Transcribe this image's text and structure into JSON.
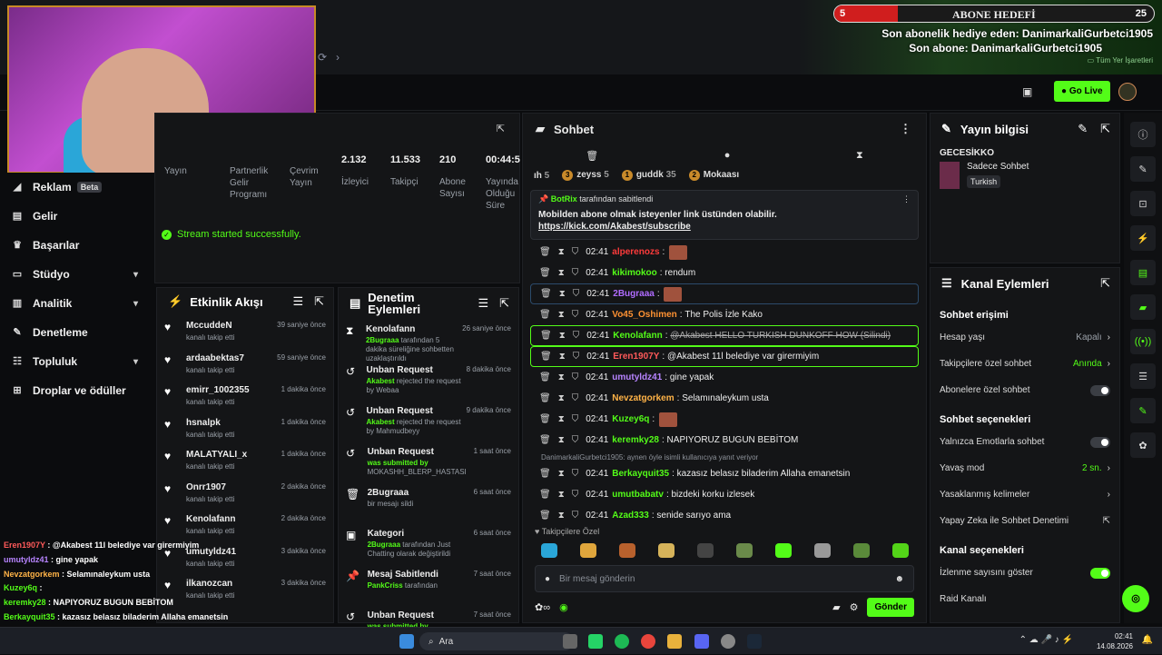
{
  "overlay": {
    "sub_goal_title": "ABONE HEDEFİ",
    "sub_goal_left": "5",
    "sub_goal_right": "25",
    "last_gift": "Son abonelik hediye eden: DanimarkaliGurbetci1905",
    "last_sub": "Son abone: DanimarkaliGurbetci1905",
    "bookmarks": "Tüm Yer İşaretleri"
  },
  "header": {
    "go_live": "Go Live"
  },
  "sidebar": {
    "items": [
      {
        "label": "Reklam",
        "icon": "megaphone-icon",
        "badge": "Beta"
      },
      {
        "label": "Gelir",
        "icon": "revenue-icon"
      },
      {
        "label": "Başarılar",
        "icon": "trophy-icon"
      },
      {
        "label": "Stüdyo",
        "icon": "studio-icon",
        "chevron": true
      },
      {
        "label": "Analitik",
        "icon": "chart-icon",
        "chevron": true
      },
      {
        "label": "Denetleme",
        "icon": "wrench-icon"
      },
      {
        "label": "Topluluk",
        "icon": "people-icon",
        "chevron": true
      },
      {
        "label": "Droplar ve ödüller",
        "icon": "gift-icon"
      }
    ]
  },
  "stats": {
    "items": [
      {
        "value": "",
        "label": "Yayın"
      },
      {
        "value": "",
        "label": "Partnerlik Gelir Programı"
      },
      {
        "value": "",
        "label": "Çevrim Yayın"
      },
      {
        "value": "2.132",
        "label": "İzleyici"
      },
      {
        "value": "11.533",
        "label": "Takipçi"
      },
      {
        "value": "210",
        "label": "Abone Sayısı"
      },
      {
        "value": "00:44:5",
        "label": "Yayında Olduğu Süre"
      }
    ],
    "success": "Stream started successfully."
  },
  "activity": {
    "title": "Etkinlik Akışı",
    "items": [
      {
        "name": "MccuddeN",
        "sub": "kanalı takip etti",
        "time": "39 saniye önce"
      },
      {
        "name": "ardaabektas7",
        "sub": "kanalı takip etti",
        "time": "59 saniye önce"
      },
      {
        "name": "emirr_1002355",
        "sub": "kanalı takip etti",
        "time": "1 dakika önce"
      },
      {
        "name": "hsnalpk",
        "sub": "kanalı takip etti",
        "time": "1 dakika önce"
      },
      {
        "name": "MALATYALI_x",
        "sub": "kanalı takip etti",
        "time": "1 dakika önce"
      },
      {
        "name": "Onrr1907",
        "sub": "kanalı takip etti",
        "time": "2 dakika önce"
      },
      {
        "name": "Kenolafann",
        "sub": "kanalı takip etti",
        "time": "2 dakika önce"
      },
      {
        "name": "umutyldz41",
        "sub": "kanalı takip etti",
        "time": "3 dakika önce"
      },
      {
        "name": "ilkanozcan",
        "sub": "kanalı takip etti",
        "time": "3 dakika önce"
      }
    ]
  },
  "moderation": {
    "title": "Denetim Eylemleri",
    "items": [
      {
        "icon": "hourglass-icon",
        "name": "Kenolafann",
        "sub_a": "2Bugraaa",
        "sub_b": " tarafından 5 dakika süreliğine sohbetten uzaklaştırıldı",
        "time": "26 saniye önce"
      },
      {
        "icon": "undo-icon",
        "name": "Unban Request",
        "sub_a": "Akabest",
        "sub_b": " rejected the request by Webaa",
        "time": "8 dakika önce"
      },
      {
        "icon": "undo-icon",
        "name": "Unban Request",
        "sub_a": "Akabest",
        "sub_b": " rejected the request by Mahmudbeyy",
        "time": "9 dakika önce"
      },
      {
        "icon": "undo-icon",
        "name": "Unban Request",
        "sub_a": "was submitted by ",
        "sub_b": "MOKASHH_BLERP_HASTASI",
        "time": "1 saat önce"
      },
      {
        "icon": "trash-icon",
        "name": "2Bugraaa",
        "sub_a": "",
        "sub_b": "bir mesajı sildi",
        "time": "6 saat önce"
      },
      {
        "icon": "category-icon",
        "name": "Kategori",
        "sub_a": "2Bugraaa",
        "sub_b": " tarafından Just Chatting olarak değiştirildi",
        "time": "6 saat önce"
      },
      {
        "icon": "pin-icon",
        "name": "Mesaj Sabitlendi",
        "sub_a": "PankCriss",
        "sub_b": " tarafından",
        "time": "7 saat önce"
      },
      {
        "icon": "undo-icon",
        "name": "Unban Request",
        "sub_a": "was submitted by ",
        "sub_b": "Mahmudbeyy",
        "time": "7 saat önce"
      }
    ]
  },
  "chat": {
    "title": "Sohbet",
    "leaders": [
      {
        "name": "ıh",
        "count": "5"
      },
      {
        "name": "zeyss",
        "count": "5",
        "rank": "3"
      },
      {
        "name": "guddk",
        "count": "35",
        "rank": "1"
      },
      {
        "name": "Mokaası",
        "count": "",
        "rank": "2"
      }
    ],
    "pinned": {
      "by_user": "BotRix",
      "by_text": " tarafından sabitlendi",
      "message": "Mobilden abone olmak isteyenler link üstünden olabilir.",
      "link": "https://kick.com/Akabest/subscribe"
    },
    "messages": [
      {
        "time": "02:41",
        "user": "alperenozs",
        "color": "#ff3b3b",
        "text": "",
        "emote": true
      },
      {
        "time": "02:41",
        "user": "kikimokoo",
        "color": "#53fc18",
        "text": "rendum"
      },
      {
        "time": "02:41",
        "user": "2Bugraaa",
        "color": "#b06cff",
        "text": "",
        "emote": true,
        "box": "hb"
      },
      {
        "time": "02:41",
        "user": "Vo45_Oshimen",
        "color": "#ff9233",
        "text": "The Polis İzle Kako"
      },
      {
        "time": "02:41",
        "user": "Kenolafann",
        "color": "#53fc18",
        "text": "@Akabest HELLO TURKISH DUNKOFF HOW (Silindi)",
        "strike": true,
        "box": "hl"
      },
      {
        "time": "02:41",
        "user": "Eren1907Y",
        "color": "#ff5a5a",
        "text": "@Akabest 11l belediye var girermiyim",
        "box": "hl"
      },
      {
        "time": "02:41",
        "user": "umutyldz41",
        "color": "#b784ff",
        "text": "gine yapak"
      },
      {
        "time": "02:41",
        "user": "Nevzatgorkem",
        "color": "#ffb347",
        "text": "Selamınaleykum usta"
      },
      {
        "time": "02:41",
        "user": "Kuzey6q",
        "color": "#53fc18",
        "text": "",
        "emote": true
      },
      {
        "time": "02:41",
        "user": "keremky28",
        "color": "#53fc18",
        "text": "NAPIYORUZ BUGUN BEBİTOM"
      }
    ],
    "reply_line": "DanimarkaliGurbetci1905: aynen öyle isimli kullanıcıya yanıt veriyor",
    "messages2": [
      {
        "time": "02:41",
        "user": "Berkayquit35",
        "color": "#53fc18",
        "text": "kazasız belasız biladerim Allaha emanetsin"
      },
      {
        "time": "02:41",
        "user": "umutbabatv",
        "color": "#53fc18",
        "text": "bizdeki korku izlesek"
      },
      {
        "time": "02:41",
        "user": "Azad333",
        "color": "#53fc18",
        "text": "senide sarıyo ama"
      }
    ],
    "followers_label": "Takipçilere Özel",
    "input_placeholder": "Bir mesaj gönderin",
    "send": "Gönder"
  },
  "info": {
    "title": "Yayın bilgisi",
    "stream_title": "GECESİKKO",
    "category": "Sadece Sohbet",
    "tag": "Turkish"
  },
  "actions": {
    "title": "Kanal Eylemleri",
    "sections": {
      "chat_access": "Sohbet erişimi",
      "chat_options": "Sohbet seçenekleri",
      "channel_options": "Kanal seçenekleri"
    },
    "account_age": {
      "label": "Hesap yaşı",
      "value": "Kapalı"
    },
    "followers_only": {
      "label": "Takipçilere özel sohbet",
      "value": "Anında"
    },
    "subs_only": {
      "label": "Abonelere özel sohbet"
    },
    "emote_only": {
      "label": "Yalnızca Emotlarla sohbet"
    },
    "slow_mode": {
      "label": "Yavaş mod",
      "value": "2 sn."
    },
    "banned_words": {
      "label": "Yasaklanmış kelimeler"
    },
    "ai_mod": {
      "label": "Yapay Zeka ile Sohbet Denetimi"
    },
    "viewer_count": {
      "label": "İzlenme sayısını göster"
    },
    "raid": {
      "label": "Raid Kanalı"
    }
  },
  "overlay_chat": [
    {
      "user": "Eren1907Y",
      "color": "#ff5a5a",
      "text": "@Akabest 11l belediye var girermiyim"
    },
    {
      "user": "umutyldz41",
      "color": "#b784ff",
      "text": "gine yapak"
    },
    {
      "user": "Nevzatgorkem",
      "color": "#ffb347",
      "text": "Selamınaleykum usta"
    },
    {
      "user": "Kuzey6q",
      "color": "#53fc18",
      "text": ""
    },
    {
      "user": "keremky28",
      "color": "#53fc18",
      "text": "NAPIYORUZ BUGUN BEBİTOM"
    },
    {
      "user": "Berkayquit35",
      "color": "#53fc18",
      "text": "kazasız belasız biladerim Allaha emanetsin"
    },
    {
      "user": "umutbabatv",
      "color": "#53fc18",
      "text": "bizdeki korku izlesek"
    },
    {
      "user": "Azad333",
      "color": "#53fc18",
      "text": "senide sarıyo ama"
    }
  ],
  "taskbar": {
    "search": "Ara",
    "time": "02:41",
    "date": "14.08.2026"
  },
  "colors": {
    "accent": "#53fc18",
    "panel": "#141517",
    "bg": "#0b0c0e"
  }
}
